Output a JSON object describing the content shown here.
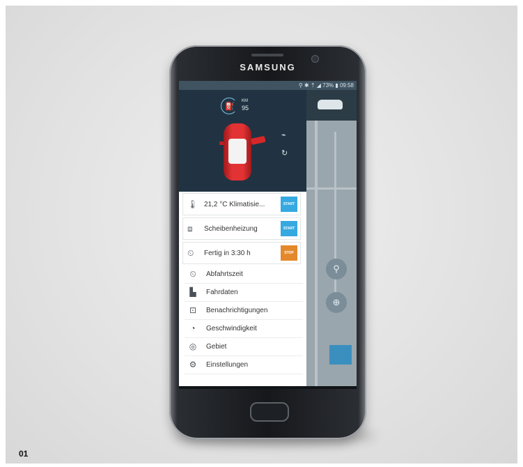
{
  "figure": {
    "number": "01"
  },
  "device": {
    "brand": "SAMSUNG"
  },
  "statusbar": {
    "text": "⚲ ✱ ⇡ ◢ 73% ▮ 09:58"
  },
  "vehicle": {
    "range_unit": "KM",
    "range_value": "95"
  },
  "actions": [
    {
      "label": "21,2 °C Klimatisie...",
      "button": "START",
      "color": "#35a9e0",
      "icon": "thermometer-icon"
    },
    {
      "label": "Scheibenheizung",
      "button": "START",
      "color": "#35a9e0",
      "icon": "window-heater-icon"
    },
    {
      "label": "Fertig in 3:30 h",
      "button": "STOP",
      "color": "#e3892b",
      "icon": "clock-timer-icon"
    }
  ],
  "menu": [
    {
      "label": "Abfahrtszeit",
      "icon": "departure-time-icon"
    },
    {
      "label": "Fahrdaten",
      "icon": "bar-chart-icon"
    },
    {
      "label": "Benachrichtigungen",
      "icon": "notification-icon"
    },
    {
      "label": "Geschwindigkeit",
      "icon": "speedometer-icon"
    },
    {
      "label": "Gebiet",
      "icon": "area-icon"
    },
    {
      "label": "Einstellungen",
      "icon": "settings-icon"
    }
  ],
  "colors": {
    "accent_blue": "#35a9e0",
    "stop_orange": "#e3892b",
    "drawer_header": "#213342"
  }
}
